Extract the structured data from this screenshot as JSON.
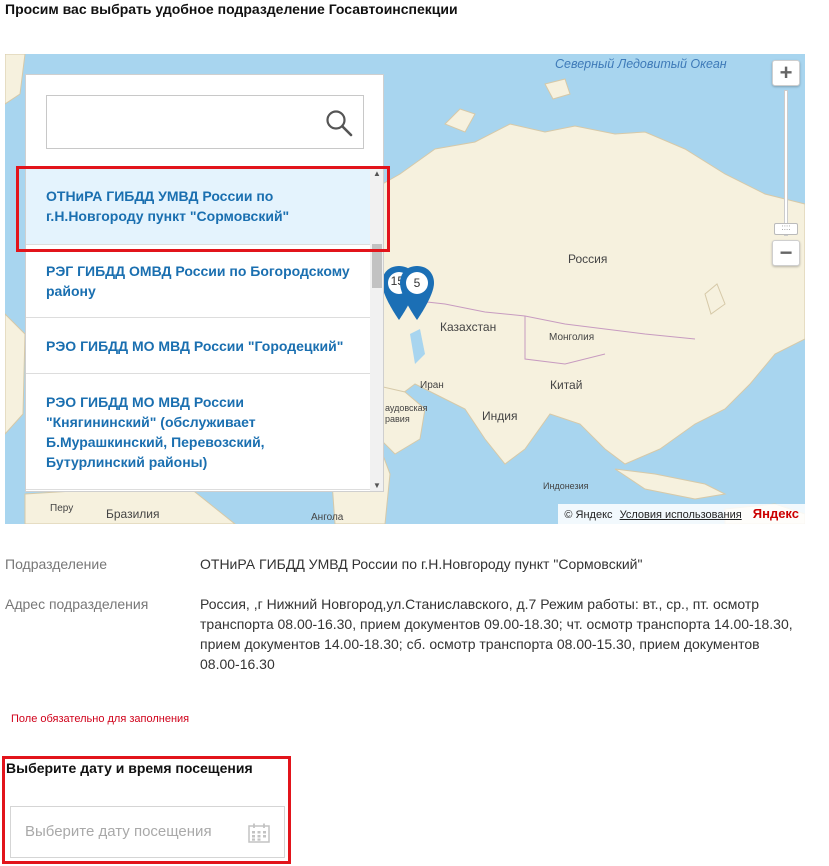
{
  "heading": "Просим вас выбрать удобное подразделение Госавтоинспекции",
  "map": {
    "labels": {
      "ocean": "Северный Ледовитый Океан",
      "russia": "Россия",
      "kazakhstan": "Казахстан",
      "mongolia": "Монголия",
      "china": "Китай",
      "iran": "Иран",
      "india": "Индия",
      "saudi": "аудовская\nравия",
      "indonesia": "Индонезия",
      "peru": "Перу",
      "brazil": "Бразилия",
      "angola": "Ангола"
    },
    "pins": [
      "15",
      "5"
    ],
    "zoom_in": "+",
    "zoom_out": "−",
    "zoom_thumb": "::::",
    "copyright": "© Яндекс",
    "terms": "Условия использования",
    "logo": "Яндекс"
  },
  "search": {
    "placeholder": ""
  },
  "list": [
    "ОТНиРА ГИБДД УМВД России по г.Н.Новгороду пункт \"Сормовский\"",
    "РЭГ ГИБДД ОМВД России по Богородскому району",
    "РЭО ГИБДД МО МВД России \"Городецкий\"",
    "РЭО ГИБДД МО МВД России \"Княгининский\" (обслуживает Б.Мурашкинский, Перевозский, Бутурлинский районы)"
  ],
  "info": {
    "division_label": "Подразделение",
    "division_value": "ОТНиРА ГИБДД УМВД России по г.Н.Новгороду пункт \"Сормовский\"",
    "address_label": "Адрес подразделения",
    "address_value": "Россия, ,г Нижний Новгород,ул.Станиславского, д.7 Режим работы: вт., ср., пт. осмотр транспорта 08.00-16.30, прием документов 09.00-18.30; чт. осмотр транспорта 14.00-18.30, прием документов 14.00-18.30; сб. осмотр транспорта 08.00-15.30, прием документов 08.00-16.30"
  },
  "required_note": "Поле обязательно для заполнения",
  "date": {
    "title": "Выберите дату и время посещения",
    "placeholder": "Выберите дату посещения"
  },
  "colors": {
    "accent": "#1a6fb0",
    "highlight": "#e2141b",
    "selected_bg": "#e4f3fd",
    "pin": "#1b6fb5"
  }
}
